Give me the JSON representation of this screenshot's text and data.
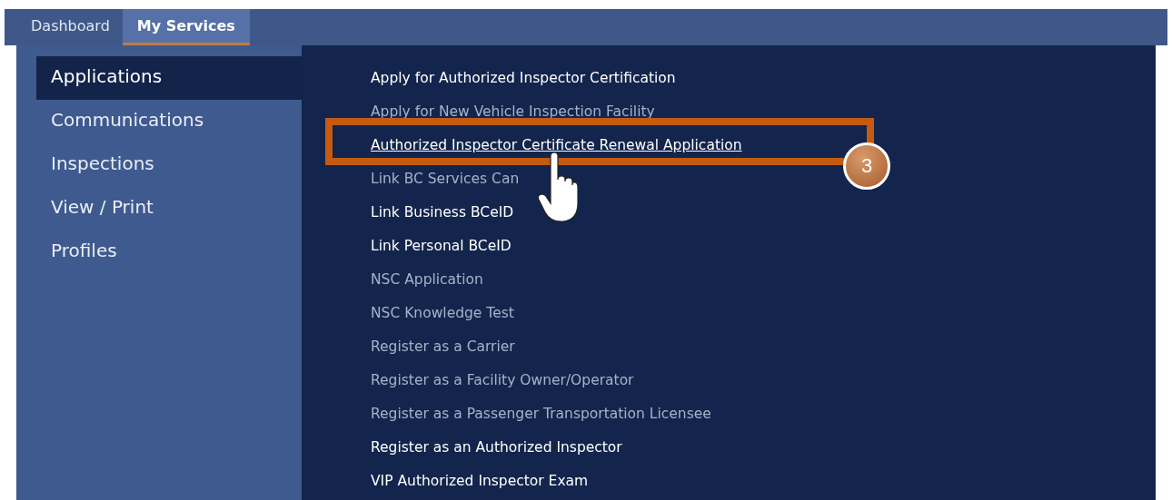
{
  "tabs": [
    {
      "label": "Dashboard",
      "selected": false
    },
    {
      "label": "My Services",
      "selected": true
    }
  ],
  "sidebar": {
    "items": [
      {
        "label": "Applications",
        "selected": true
      },
      {
        "label": "Communications",
        "selected": false
      },
      {
        "label": "Inspections",
        "selected": false
      },
      {
        "label": "View / Print",
        "selected": false
      },
      {
        "label": "Profiles",
        "selected": false
      }
    ]
  },
  "services": [
    {
      "label": "Apply for Authorized Inspector Certification",
      "disabled": false,
      "hovered": false
    },
    {
      "label": "Apply for New Vehicle Inspection Facility",
      "disabled": true,
      "hovered": false
    },
    {
      "label": "Authorized Inspector Certificate Renewal Application",
      "disabled": false,
      "hovered": true
    },
    {
      "label": "Link BC Services Can",
      "disabled": true,
      "hovered": false
    },
    {
      "label": "Link Business BCeID",
      "disabled": false,
      "hovered": false
    },
    {
      "label": "Link Personal BCeID",
      "disabled": false,
      "hovered": false
    },
    {
      "label": "NSC Application",
      "disabled": true,
      "hovered": false
    },
    {
      "label": "NSC Knowledge Test",
      "disabled": true,
      "hovered": false
    },
    {
      "label": "Register as a Carrier",
      "disabled": true,
      "hovered": false
    },
    {
      "label": "Register as a Facility Owner/Operator",
      "disabled": true,
      "hovered": false
    },
    {
      "label": "Register as a Passenger Transportation Licensee",
      "disabled": true,
      "hovered": false
    },
    {
      "label": "Register as an Authorized Inspector",
      "disabled": false,
      "hovered": false
    },
    {
      "label": "VIP Authorized Inspector Exam",
      "disabled": false,
      "hovered": false
    }
  ],
  "annotation": {
    "label": "3"
  }
}
